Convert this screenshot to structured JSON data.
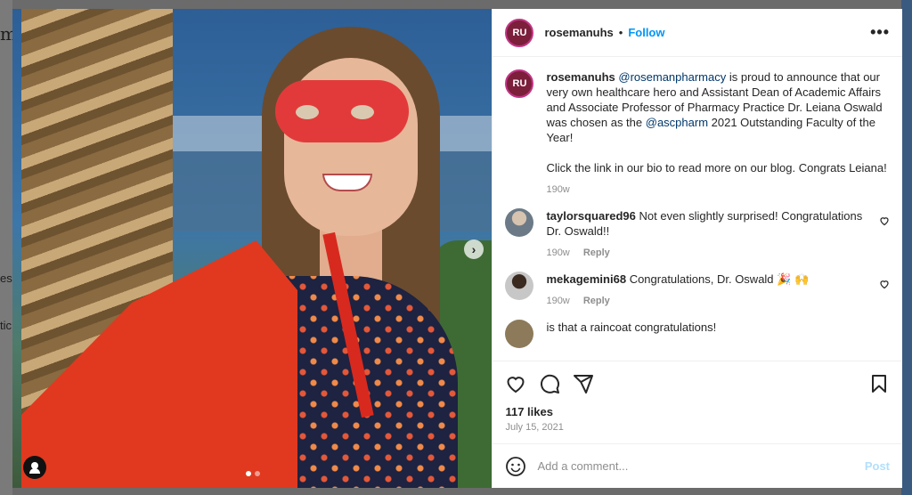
{
  "background": {
    "side_text": [
      "m",
      "es",
      "tic"
    ]
  },
  "header": {
    "avatar_initials": "RU",
    "username": "rosemanuhs",
    "separator": "•",
    "follow_label": "Follow",
    "more_icon": "more-horizontal-icon"
  },
  "caption": {
    "avatar_initials": "RU",
    "username": "rosemanuhs",
    "mention1": "@rosemanpharmacy",
    "text1": " is proud to announce that our very own healthcare hero and Assistant Dean of Academic Affairs and Associate Professor of Pharmacy Practice Dr. Leiana Oswald was chosen as the ",
    "mention2": "@ascpharm",
    "text2": " 2021 Outstanding Faculty of the Year!",
    "paragraph2": "Click the link in our bio to read more on our blog. Congrats Leiana!",
    "time": "190w"
  },
  "comments": [
    {
      "username": "taylorsquared96",
      "text": "Not even slightly surprised! Congratulations Dr. Oswald!!",
      "time": "190w",
      "reply": "Reply"
    },
    {
      "username": "mekagemini68",
      "text": "Congratulations, Dr. Oswald 🎉 🙌",
      "time": "190w",
      "reply": "Reply"
    },
    {
      "username": "",
      "text": "is that a raincoat congratulations!",
      "time": "",
      "reply": ""
    }
  ],
  "actions": {
    "like_icon": "heart-icon",
    "comment_icon": "comment-icon",
    "share_icon": "send-icon",
    "save_icon": "bookmark-icon"
  },
  "likes": "117 likes",
  "date": "July 15, 2021",
  "add_comment": {
    "placeholder": "Add a comment...",
    "post_label": "Post",
    "emoji_icon": "emoji-icon"
  },
  "colors": {
    "follow": "#0095f6",
    "link": "#00376b",
    "post_disabled": "#b2dffc",
    "muted": "#8e8e8e"
  }
}
